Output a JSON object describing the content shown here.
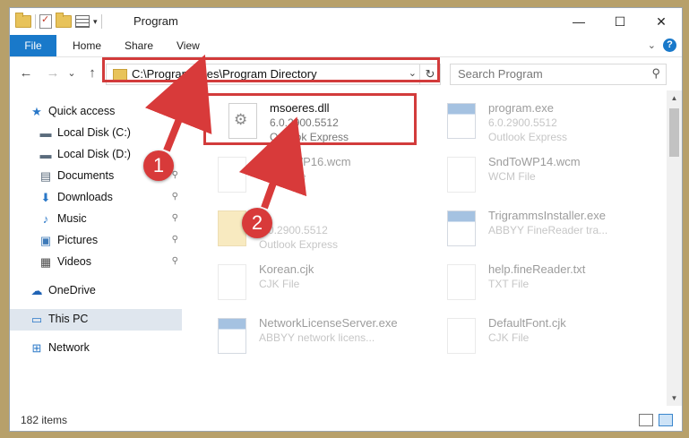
{
  "window": {
    "title": "Program",
    "controls": {
      "minimize": "—",
      "maximize": "☐",
      "close": "✕"
    }
  },
  "ribbon": {
    "tabs": [
      "File",
      "Home",
      "Share",
      "View"
    ],
    "help": "?",
    "expand": "⌄"
  },
  "nav": {
    "back": "←",
    "forward": "→",
    "recent": "⌄",
    "up": "↑",
    "address": "C:\\Program Files\\Program Directory",
    "address_dropdown": "⌄",
    "refresh": "↻",
    "search_placeholder": "Search Program",
    "search_icon": "⚲"
  },
  "sidebar": {
    "items": [
      {
        "label": "Quick access",
        "icon": "star-icon",
        "glyph": "★",
        "color": "#2a78c8",
        "pinned": false
      },
      {
        "label": "Local Disk (C:)",
        "icon": "drive-icon",
        "glyph": "▬",
        "color": "#5a6b7c",
        "pinned": true
      },
      {
        "label": "Local Disk (D:)",
        "icon": "drive-icon",
        "glyph": "▬",
        "color": "#5a6b7c",
        "pinned": true
      },
      {
        "label": "Documents",
        "icon": "documents-icon",
        "glyph": "▤",
        "color": "#5a6b7c",
        "pinned": true
      },
      {
        "label": "Downloads",
        "icon": "downloads-icon",
        "glyph": "⬇",
        "color": "#2a78c8",
        "pinned": true
      },
      {
        "label": "Music",
        "icon": "music-icon",
        "glyph": "♪",
        "color": "#2a78c8",
        "pinned": true
      },
      {
        "label": "Pictures",
        "icon": "pictures-icon",
        "glyph": "▣",
        "color": "#3d7ab8",
        "pinned": true
      },
      {
        "label": "Videos",
        "icon": "videos-icon",
        "glyph": "▦",
        "color": "#4a4a4a",
        "pinned": true
      },
      {
        "label": "OneDrive",
        "icon": "cloud-icon",
        "glyph": "☁",
        "color": "#1f63b5",
        "pinned": false
      },
      {
        "label": "This PC",
        "icon": "computer-icon",
        "glyph": "▭",
        "color": "#2a78c8",
        "pinned": false,
        "selected": true
      },
      {
        "label": "Network",
        "icon": "network-icon",
        "glyph": "⊞",
        "color": "#2a78c8",
        "pinned": false
      }
    ],
    "pin_glyph": "📌"
  },
  "files": [
    {
      "name": "msoeres.dll",
      "line1": "6.0.2900.5512",
      "line2": "Outlook Express",
      "icon": "gear",
      "highlighted": true
    },
    {
      "name": "program.exe",
      "line1": "6.0.2900.5512",
      "line2": "Outlook Express",
      "icon": "app",
      "highlighted": false
    },
    {
      "name": "SndToWP16.wcm",
      "line1": "WCM File",
      "line2": "",
      "icon": "blank",
      "highlighted": false
    },
    {
      "name": "SndToWP14.wcm",
      "line1": "WCM File",
      "line2": "",
      "icon": "blank",
      "highlighted": false
    },
    {
      "name": "",
      "line1": "6.0.2900.5512",
      "line2": "Outlook Express",
      "icon": "folder",
      "highlighted": false
    },
    {
      "name": "TrigrammsInstaller.exe",
      "line1": "ABBYY FineReader tra...",
      "line2": "",
      "icon": "app",
      "highlighted": false
    },
    {
      "name": "Korean.cjk",
      "line1": "CJK File",
      "line2": "",
      "icon": "blank",
      "highlighted": false
    },
    {
      "name": "help.fineReader.txt",
      "line1": "TXT File",
      "line2": "",
      "icon": "blank",
      "highlighted": false
    },
    {
      "name": "NetworkLicenseServer.exe",
      "line1": "ABBYY network licens...",
      "line2": "",
      "icon": "app",
      "highlighted": false
    },
    {
      "name": "DefaultFont.cjk",
      "line1": "CJK File",
      "line2": "",
      "icon": "blank",
      "highlighted": false
    }
  ],
  "status": {
    "count": "182 items"
  },
  "markers": [
    "1",
    "2"
  ],
  "colors": {
    "accent": "#1979ca",
    "highlight": "#d23b3b",
    "selected_bg": "#dfe6ee"
  }
}
